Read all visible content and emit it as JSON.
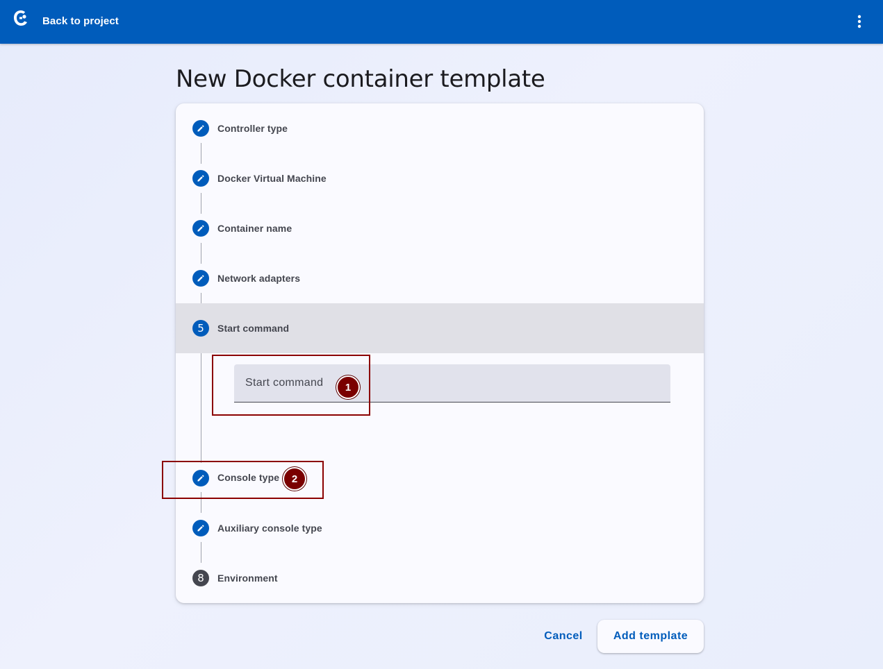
{
  "header": {
    "back_label": "Back to project",
    "logo_icon": "app-logo-icon",
    "menu_icon": "more-vert-icon",
    "bar_color": "#005cbb"
  },
  "page": {
    "title": "New Docker container template"
  },
  "stepper": {
    "steps": [
      {
        "label": "Controller type",
        "state": "done",
        "icon": "edit-icon"
      },
      {
        "label": "Docker Virtual Machine",
        "state": "done",
        "icon": "edit-icon"
      },
      {
        "label": "Container name",
        "state": "done",
        "icon": "edit-icon"
      },
      {
        "label": "Network adapters",
        "state": "done",
        "icon": "edit-icon"
      },
      {
        "label": "Start command",
        "state": "active",
        "number": "5"
      },
      {
        "label": "Console type",
        "state": "done",
        "icon": "edit-icon"
      },
      {
        "label": "Auxiliary console type",
        "state": "done",
        "icon": "edit-icon"
      },
      {
        "label": "Environment",
        "state": "pending",
        "number": "8"
      }
    ],
    "start_command_field": {
      "placeholder": "Start command",
      "value": ""
    }
  },
  "annotations": [
    {
      "number": "1",
      "target": "start-command-input"
    },
    {
      "number": "2",
      "target": "console-type-step"
    }
  ],
  "actions": {
    "cancel_label": "Cancel",
    "add_label": "Add template"
  }
}
